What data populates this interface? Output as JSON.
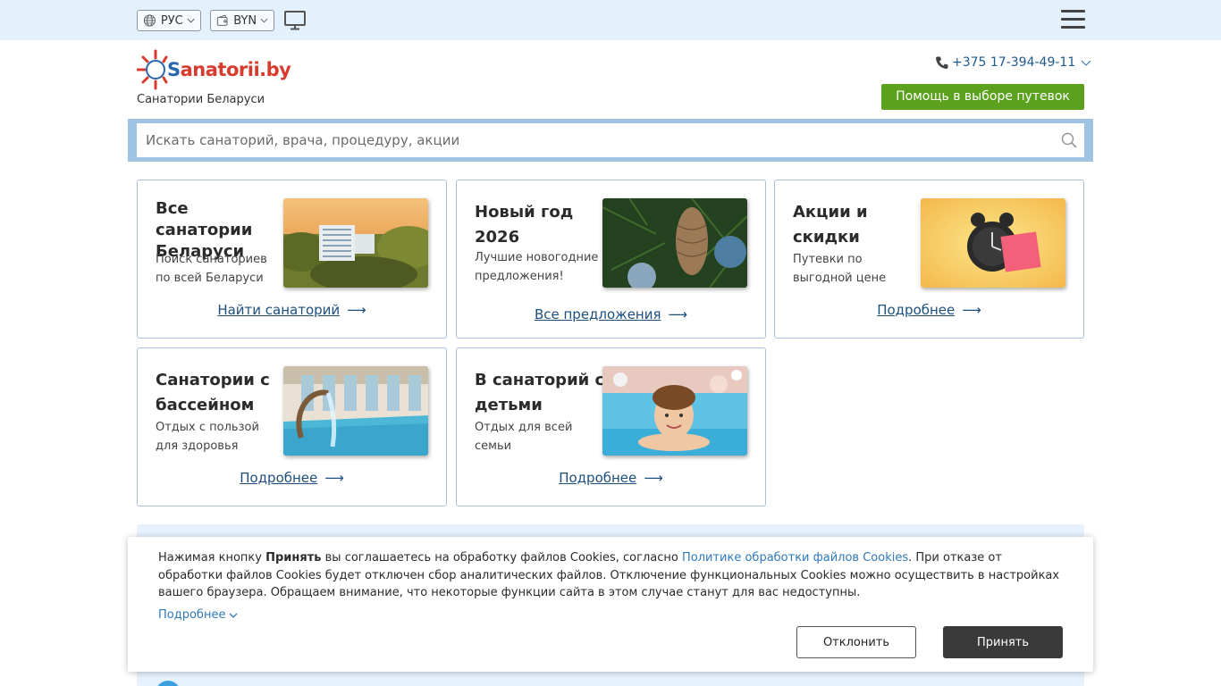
{
  "topbar": {
    "language": "РУС",
    "currency": "BYN",
    "icons": [
      "globe-icon",
      "wallet-icon",
      "desktop-icon",
      "menu-icon"
    ]
  },
  "header": {
    "logo_prefix": "S",
    "logo_rest": "anatorii.by",
    "subtitle": "Санатории Беларуси",
    "phone": "+375 17-394-49-11",
    "help_button": "Помощь в выборе путевок"
  },
  "search": {
    "placeholder": "Искать санаторий, врача, процедуру, акции"
  },
  "cards": [
    {
      "title": "Все санатории Беларуси",
      "description": "Поиск санаториев по всей Беларуси",
      "link": "Найти санаторий"
    },
    {
      "title": "Новый год 2026",
      "description": "Лучшие новогодние предложения!",
      "link": "Все предложения"
    },
    {
      "title": "Акции и скидки",
      "description": "Путевки по выгодной цене",
      "link": "Подробнее"
    },
    {
      "title": "Санатории с бассейном",
      "description": "Отдых с пользой для здоровья",
      "link": "Подробнее"
    },
    {
      "title": "В санаторий с детьми",
      "description": "Отдых для всей семьи",
      "link": "Подробнее"
    }
  ],
  "cookie": {
    "text_before": "Нажимая кнопку ",
    "accept_word": "Принять",
    "text_middle": " вы соглашаетесь на обработку файлов Cookies, согласно ",
    "policy_link": "Политике обработки файлов Cookies",
    "text_after": ". При отказе от обработки файлов Cookies будет отключен сбор аналитических файлов. Отключение функциональных Cookies можно осуществить в настройках вашего браузера. Обращаем внимание, что некоторые функции сайта в этом случае станут для вас недоступны.",
    "more": "Подробнее",
    "decline": "Отклонить",
    "accept": "Принять"
  },
  "colors": {
    "topbar_bg": "#e3f1fd",
    "accent_green": "#5ba11e",
    "link_blue": "#1d4f7e",
    "logo_red": "#d63b2e",
    "logo_blue": "#2a66ae"
  }
}
